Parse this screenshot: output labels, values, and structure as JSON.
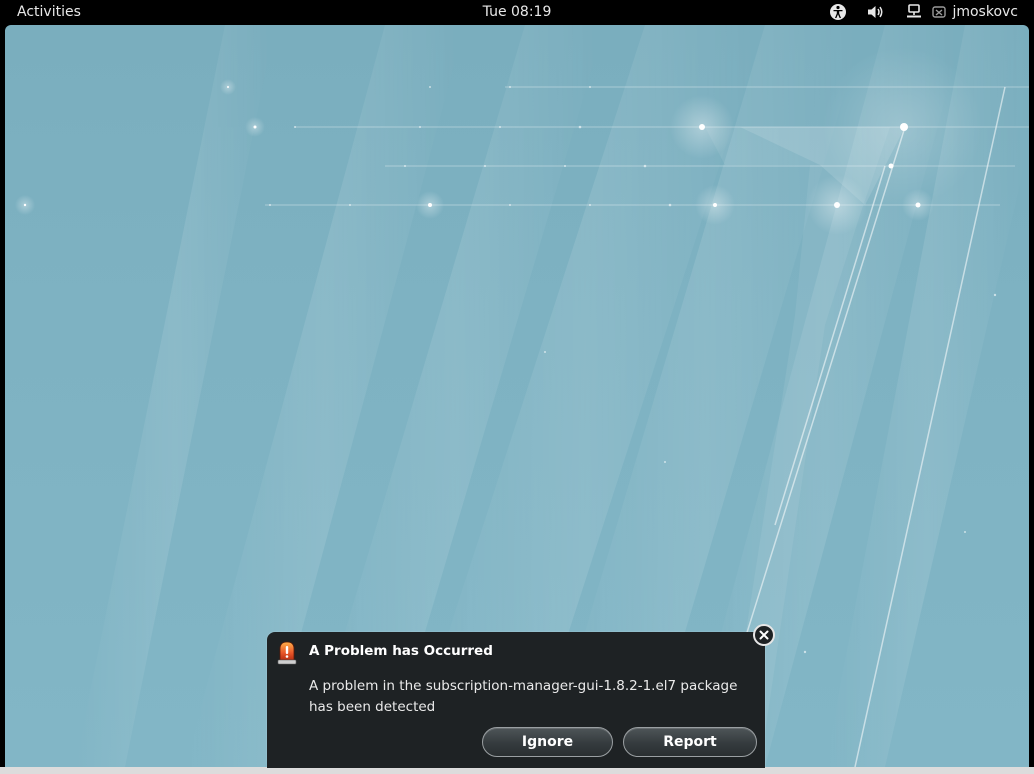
{
  "topbar": {
    "activities_label": "Activities",
    "clock": "Tue 08:19",
    "tray_icons": [
      "accessibility-icon",
      "volume-icon",
      "network-wired-icon",
      "user-status-icon"
    ],
    "username": "jmoskovc"
  },
  "notification": {
    "icon": "warning-alarm-icon",
    "title": "A Problem has Occurred",
    "body": "A problem in the subscription-manager-gui-1.8.2-1.el7 package has been detected",
    "buttons": {
      "ignore": "Ignore",
      "report": "Report"
    },
    "close_icon": "close-icon"
  },
  "colors": {
    "topbar_bg": "#000000",
    "desktop_bg": "#7eb2c2",
    "notification_bg": "#1e2224"
  }
}
